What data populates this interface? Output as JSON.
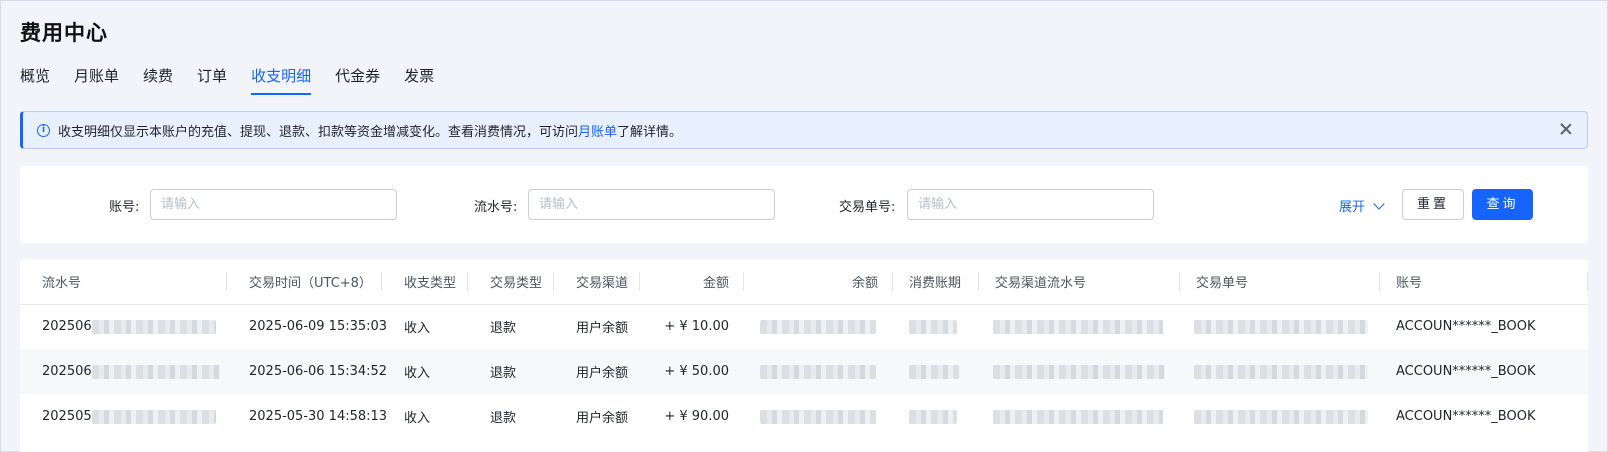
{
  "header": {
    "title": "费用中心"
  },
  "tabs": [
    {
      "label": "概览"
    },
    {
      "label": "月账单"
    },
    {
      "label": "续费"
    },
    {
      "label": "订单"
    },
    {
      "label": "收支明细"
    },
    {
      "label": "代金券"
    },
    {
      "label": "发票"
    }
  ],
  "active_tab": "收支明细",
  "alert": {
    "text_before": "收支明细仅显示本账户的充值、提现、退款、扣款等资金增减变化。查看消费情况，可访问",
    "link": "月账单",
    "text_after": "了解详情。"
  },
  "filters": {
    "account_label": "账号:",
    "account_placeholder": "请输入",
    "serial_label": "流水号:",
    "serial_placeholder": "请输入",
    "order_label": "交易单号:",
    "order_placeholder": "请输入",
    "expand_label": "展开",
    "reset_label": "重置",
    "query_label": "查询"
  },
  "table": {
    "columns": [
      "流水号",
      "交易时间（UTC+8）",
      "收支类型",
      "交易类型",
      "交易渠道",
      "金额",
      "余额",
      "消费账期",
      "交易渠道流水号",
      "交易单号",
      "账号"
    ],
    "rows": [
      {
        "serial_prefix": "202506",
        "time": "2025-06-09 15:35:03",
        "direction": "收入",
        "type": "退款",
        "channel": "用户余额",
        "amount": "+ ¥  10.00",
        "account": "ACCOUN******_BOOK"
      },
      {
        "serial_prefix": "202506",
        "time": "2025-06-06 15:34:52",
        "direction": "收入",
        "type": "退款",
        "channel": "用户余额",
        "amount": "+ ¥  50.00",
        "account": "ACCOUN******_BOOK"
      },
      {
        "serial_prefix": "202505",
        "time": "2025-05-30 14:58:13",
        "direction": "收入",
        "type": "退款",
        "channel": "用户余额",
        "amount": "+ ¥  90.00",
        "account": "ACCOUN******_BOOK"
      }
    ]
  },
  "colors": {
    "accent": "#1664ff",
    "alert_bg": "#e8f0fe",
    "page_bg": "#f2f4f9"
  }
}
